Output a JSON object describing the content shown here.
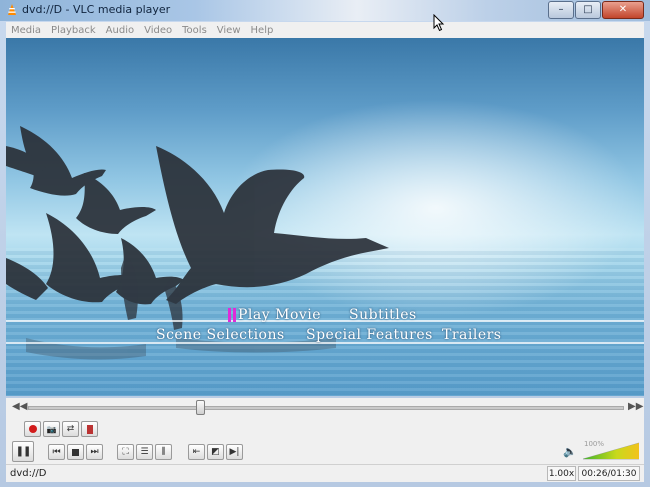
{
  "window": {
    "title": "dvd://D - VLC media player",
    "buttons": {
      "minimize": "–",
      "maximize": "□",
      "close": "✕"
    }
  },
  "menu": [
    "Media",
    "Playback",
    "Audio",
    "Video",
    "Tools",
    "View",
    "Help"
  ],
  "dvd_menu": {
    "row1": [
      "Play Movie",
      "Subtitles"
    ],
    "row2": [
      "Scene Selections",
      "Special Features",
      "Trailers"
    ],
    "highlight_color": "#e02ad8"
  },
  "playback": {
    "position_fraction": 0.29
  },
  "volume": {
    "percent_label": "100%",
    "level_fraction": 1.0
  },
  "status": {
    "source": "dvd://D",
    "speed": "1.00x",
    "time": "00:26/01:30"
  },
  "icons": {
    "record": "record-icon",
    "snapshot": "snapshot-icon",
    "loop": "loop-ab-icon",
    "frame": "frame-step-icon",
    "pause": "pause-icon",
    "prev": "previous-icon",
    "stop": "stop-icon",
    "next": "next-icon",
    "fullscreen": "fullscreen-icon",
    "playlist": "playlist-icon",
    "effects": "extended-settings-icon",
    "loopmode": "loop-icon",
    "random": "random-icon",
    "frameadv": "frame-by-frame-icon",
    "volume": "speaker-icon"
  }
}
